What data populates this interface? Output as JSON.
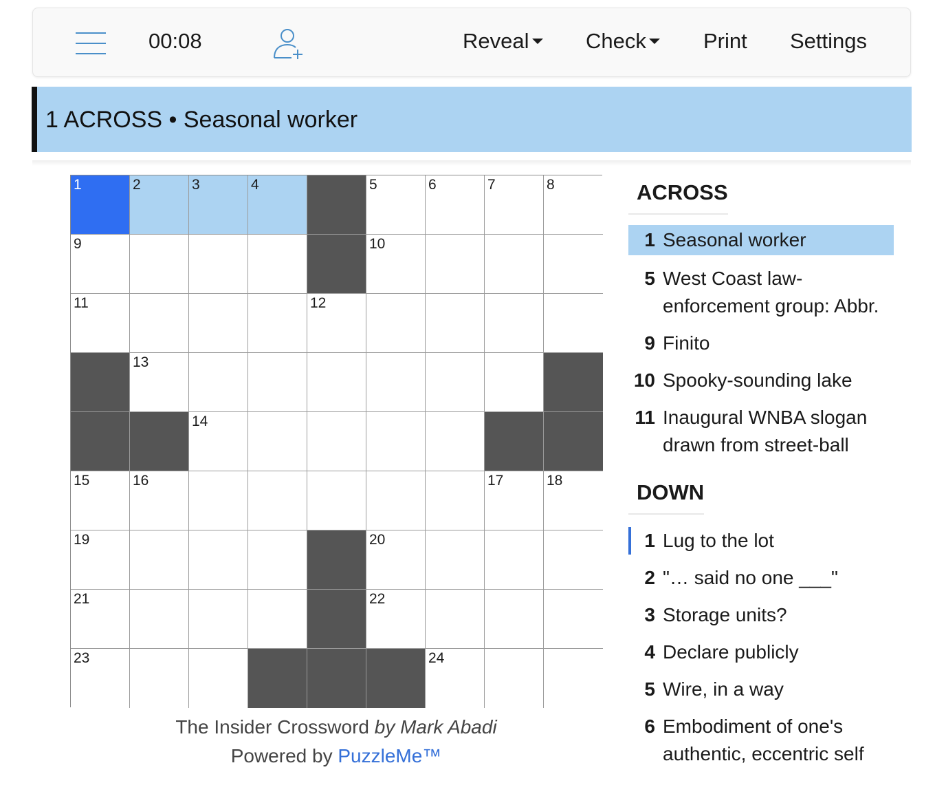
{
  "toolbar": {
    "timer": "00:08",
    "reveal_label": "Reveal",
    "check_label": "Check",
    "print_label": "Print",
    "settings_label": "Settings",
    "accent_color": "#4a8fc9"
  },
  "current_clue": {
    "text": "1 ACROSS • Seasonal worker"
  },
  "grid": {
    "rows": 9,
    "cols": 9,
    "blocks": [
      [
        0,
        4
      ],
      [
        1,
        4
      ],
      [
        3,
        0
      ],
      [
        3,
        8
      ],
      [
        4,
        0
      ],
      [
        4,
        1
      ],
      [
        4,
        7
      ],
      [
        4,
        8
      ],
      [
        6,
        4
      ],
      [
        7,
        4
      ],
      [
        8,
        3
      ],
      [
        8,
        4
      ],
      [
        8,
        5
      ]
    ],
    "numbers": [
      {
        "r": 0,
        "c": 0,
        "n": "1"
      },
      {
        "r": 0,
        "c": 1,
        "n": "2"
      },
      {
        "r": 0,
        "c": 2,
        "n": "3"
      },
      {
        "r": 0,
        "c": 3,
        "n": "4"
      },
      {
        "r": 0,
        "c": 5,
        "n": "5"
      },
      {
        "r": 0,
        "c": 6,
        "n": "6"
      },
      {
        "r": 0,
        "c": 7,
        "n": "7"
      },
      {
        "r": 0,
        "c": 8,
        "n": "8"
      },
      {
        "r": 1,
        "c": 0,
        "n": "9"
      },
      {
        "r": 1,
        "c": 5,
        "n": "10"
      },
      {
        "r": 2,
        "c": 0,
        "n": "11"
      },
      {
        "r": 2,
        "c": 4,
        "n": "12"
      },
      {
        "r": 3,
        "c": 1,
        "n": "13"
      },
      {
        "r": 4,
        "c": 2,
        "n": "14"
      },
      {
        "r": 5,
        "c": 0,
        "n": "15"
      },
      {
        "r": 5,
        "c": 1,
        "n": "16"
      },
      {
        "r": 5,
        "c": 7,
        "n": "17"
      },
      {
        "r": 5,
        "c": 8,
        "n": "18"
      },
      {
        "r": 6,
        "c": 0,
        "n": "19"
      },
      {
        "r": 6,
        "c": 5,
        "n": "20"
      },
      {
        "r": 7,
        "c": 0,
        "n": "21"
      },
      {
        "r": 7,
        "c": 5,
        "n": "22"
      },
      {
        "r": 8,
        "c": 0,
        "n": "23"
      },
      {
        "r": 8,
        "c": 6,
        "n": "24"
      }
    ],
    "active": [
      0,
      0
    ],
    "highlighted": [
      [
        0,
        1
      ],
      [
        0,
        2
      ],
      [
        0,
        3
      ]
    ],
    "colors": {
      "active": "#2f6ef2",
      "highlight": "#acd3f2",
      "block": "#555555"
    }
  },
  "credit": {
    "title": "The Insider Crossword",
    "author": "by Mark Abadi",
    "powered_prefix": "Powered by",
    "powered_link": "PuzzleMe™"
  },
  "across": {
    "heading": "ACROSS",
    "clues": [
      {
        "n": "1",
        "t": "Seasonal worker",
        "selected": true
      },
      {
        "n": "5",
        "t": "West Coast law-enforcement group: Abbr."
      },
      {
        "n": "9",
        "t": "Finito"
      },
      {
        "n": "10",
        "t": "Spooky-sounding lake"
      },
      {
        "n": "11",
        "t": "Inaugural WNBA slogan drawn from street-ball"
      }
    ]
  },
  "down": {
    "heading": "DOWN",
    "clues": [
      {
        "n": "1",
        "t": "Lug to the lot",
        "secondary": true
      },
      {
        "n": "2",
        "t": "\"… said no one ___\""
      },
      {
        "n": "3",
        "t": "Storage units?"
      },
      {
        "n": "4",
        "t": "Declare publicly"
      },
      {
        "n": "5",
        "t": "Wire, in a way"
      },
      {
        "n": "6",
        "t": "Embodiment of one's authentic, eccentric self"
      }
    ]
  }
}
